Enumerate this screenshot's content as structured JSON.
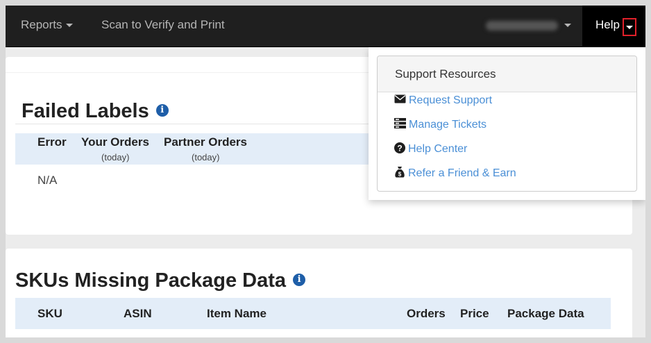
{
  "navbar": {
    "reports_label": "Reports",
    "scan_label": "Scan to Verify and Print",
    "help_label": "Help"
  },
  "failed_labels": {
    "title": "Failed Labels",
    "columns": [
      {
        "label": "Error",
        "sub": ""
      },
      {
        "label": "Your Orders",
        "sub": "(today)"
      },
      {
        "label": "Partner Orders",
        "sub": "(today)"
      }
    ],
    "rows": [
      [
        "N/A"
      ]
    ]
  },
  "skus_missing": {
    "title": "SKUs Missing Package Data",
    "columns": [
      "SKU",
      "ASIN",
      "Item Name",
      "Orders",
      "Price",
      "Package Data"
    ]
  },
  "help_menu": {
    "header": "Support Resources",
    "items": [
      {
        "label": "Request Support",
        "icon": "envelope-icon"
      },
      {
        "label": "Manage Tickets",
        "icon": "server-icon"
      },
      {
        "label": "Help Center",
        "icon": "question-circle-icon"
      },
      {
        "label": "Refer a Friend & Earn",
        "icon": "money-bag-icon"
      }
    ]
  },
  "colors": {
    "navbar": "#1f1f1f",
    "link": "#4a8fd6",
    "table_header": "#e3edf8",
    "info_icon": "#1e5ea8",
    "highlight": "#e0202a"
  }
}
